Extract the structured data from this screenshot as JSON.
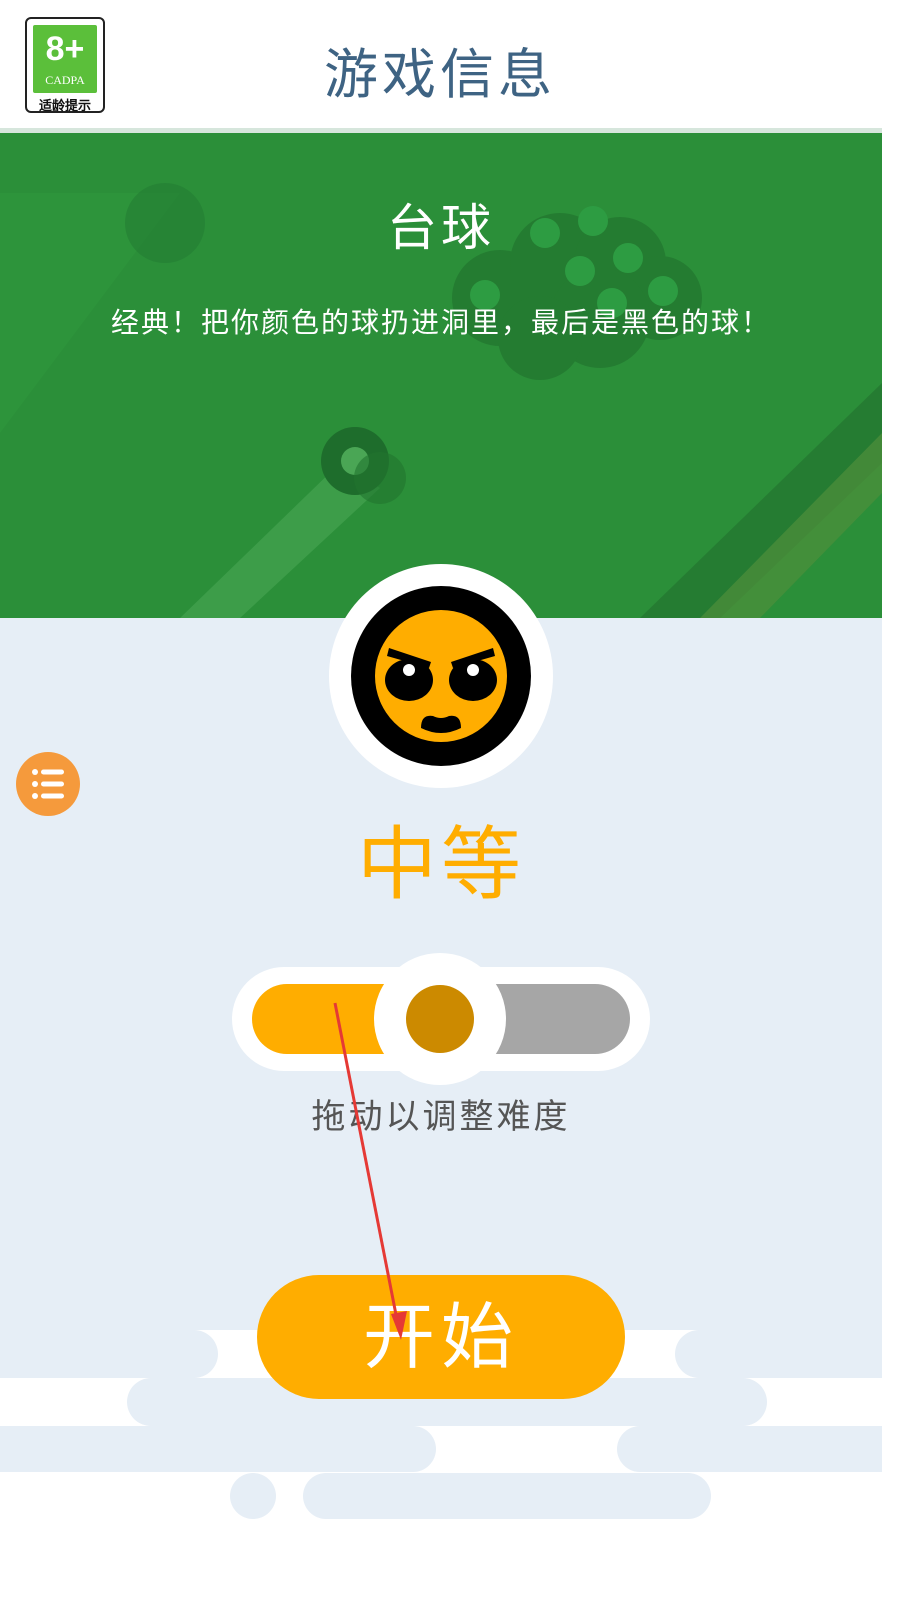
{
  "header": {
    "age_badge": {
      "rating": "8+",
      "org": "CADPA",
      "hint": "适龄提示"
    },
    "title": "游戏信息"
  },
  "game": {
    "name": "台球",
    "description": "经典！把你颜色的球扔进洞里，最后是黑色的球！"
  },
  "difficulty": {
    "label": "中等",
    "level": 0.5,
    "hint": "拖动以调整难度"
  },
  "actions": {
    "start_label": "开始"
  },
  "icons": {
    "menu": "list-menu-icon",
    "opponent": "angry-face-avatar-icon"
  },
  "colors": {
    "accent": "#ffad00",
    "thumb": "#cc8a00",
    "banner": "#2b8f39",
    "title": "#3e6383",
    "menu": "#f59a3c"
  }
}
